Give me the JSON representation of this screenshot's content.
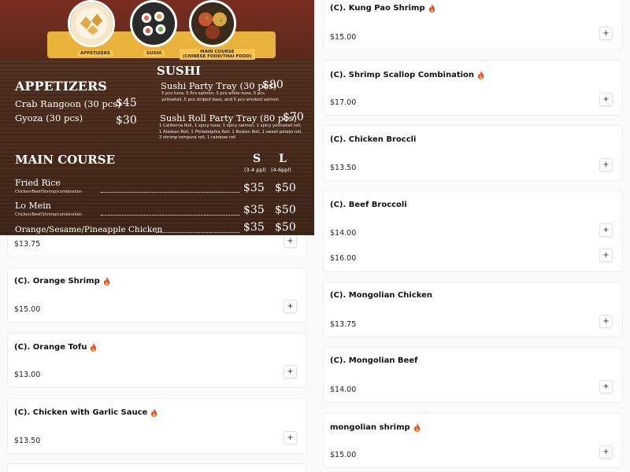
{
  "banner": {
    "dishes": [
      "APPETIZERS",
      "SUSHI",
      "MAIN COURSE\n(CHINESE FOOD/THAI FOOD)"
    ],
    "appetizers": {
      "heading": "APPETIZERS",
      "items": [
        {
          "name": "Crab Rangoon (30 pcs)",
          "price": "$45"
        },
        {
          "name": "Gyoza (30 pcs)",
          "price": "$30"
        }
      ]
    },
    "sushi": {
      "heading": "SUSHI",
      "items": [
        {
          "name": "Sushi Party Tray (30 pcs)",
          "price": "$80",
          "desc": "5 pcs tuna, 5 Pcs salmon, 5 pcs white tuna, 5 pcs yellowtail, 5 pcs striped bass, and 5 pcs smoked salmon"
        },
        {
          "name": "Sushi Roll Party Tray (80 pcs)",
          "price": "$70",
          "desc": "1 California Roll, 1 spicy tuna, 1 spicy salmon, 1 spicy yellowtail roll, 1 Alaskan Roll, 1 Philadelphia Roll, 1 Boston Roll, 1 sweet potato roll, 2 shrimp tempura roll, 1 rainbow roll"
        }
      ]
    },
    "main_course": {
      "heading": "MAIN COURSE",
      "size_s": "S",
      "size_s_note": "(3-4 ppl)",
      "size_l": "L",
      "size_l_note": "(4-6ppl)",
      "items": [
        {
          "name": "Fried Rice",
          "sub": "Chicken/Beef/Shrimp/combination",
          "s": "$35",
          "l": "$50"
        },
        {
          "name": "Lo Mein",
          "sub": "Chicken/Beef/Shrimp/combination",
          "s": "$35",
          "l": "$50"
        },
        {
          "name": "Orange/Sesame/Pineapple Chicken",
          "s": "$35",
          "l": "$50"
        }
      ]
    }
  },
  "left_cards": [
    {
      "price": "$13.75"
    },
    {
      "title": "(C). Orange Shrimp",
      "spicy": true,
      "price": "$15.00"
    },
    {
      "title": "(C). Orange Tofu",
      "spicy": true,
      "price": "$13.00"
    },
    {
      "title": "(C). Chicken with Garlic Sauce",
      "spicy": true,
      "price": "$13.50"
    }
  ],
  "right_cards": [
    {
      "title": "(C). Kung Pao Shrimp",
      "spicy": true,
      "price": "$15.00"
    },
    {
      "title": "(C). Shrimp Scallop Combination",
      "spicy": true,
      "price": "$17.00"
    },
    {
      "title": "(C). Chicken Broccli",
      "spicy": false,
      "price": "$13.50"
    },
    {
      "title": "(C). Beef Broccoli",
      "spicy": false,
      "price": "$14.00",
      "price2": "$16.00"
    },
    {
      "title": "(C). Mongolian Chicken",
      "spicy": false,
      "price": "$13.75"
    },
    {
      "title": "(C). Mongolian Beef",
      "spicy": false,
      "price": "$14.00"
    },
    {
      "title": "mongolian shrimp",
      "spicy": true,
      "price": "$15.00"
    }
  ],
  "add_label": "+",
  "colors": {
    "fire": "#e8491d",
    "banner_yellow": "#e9b33b"
  }
}
